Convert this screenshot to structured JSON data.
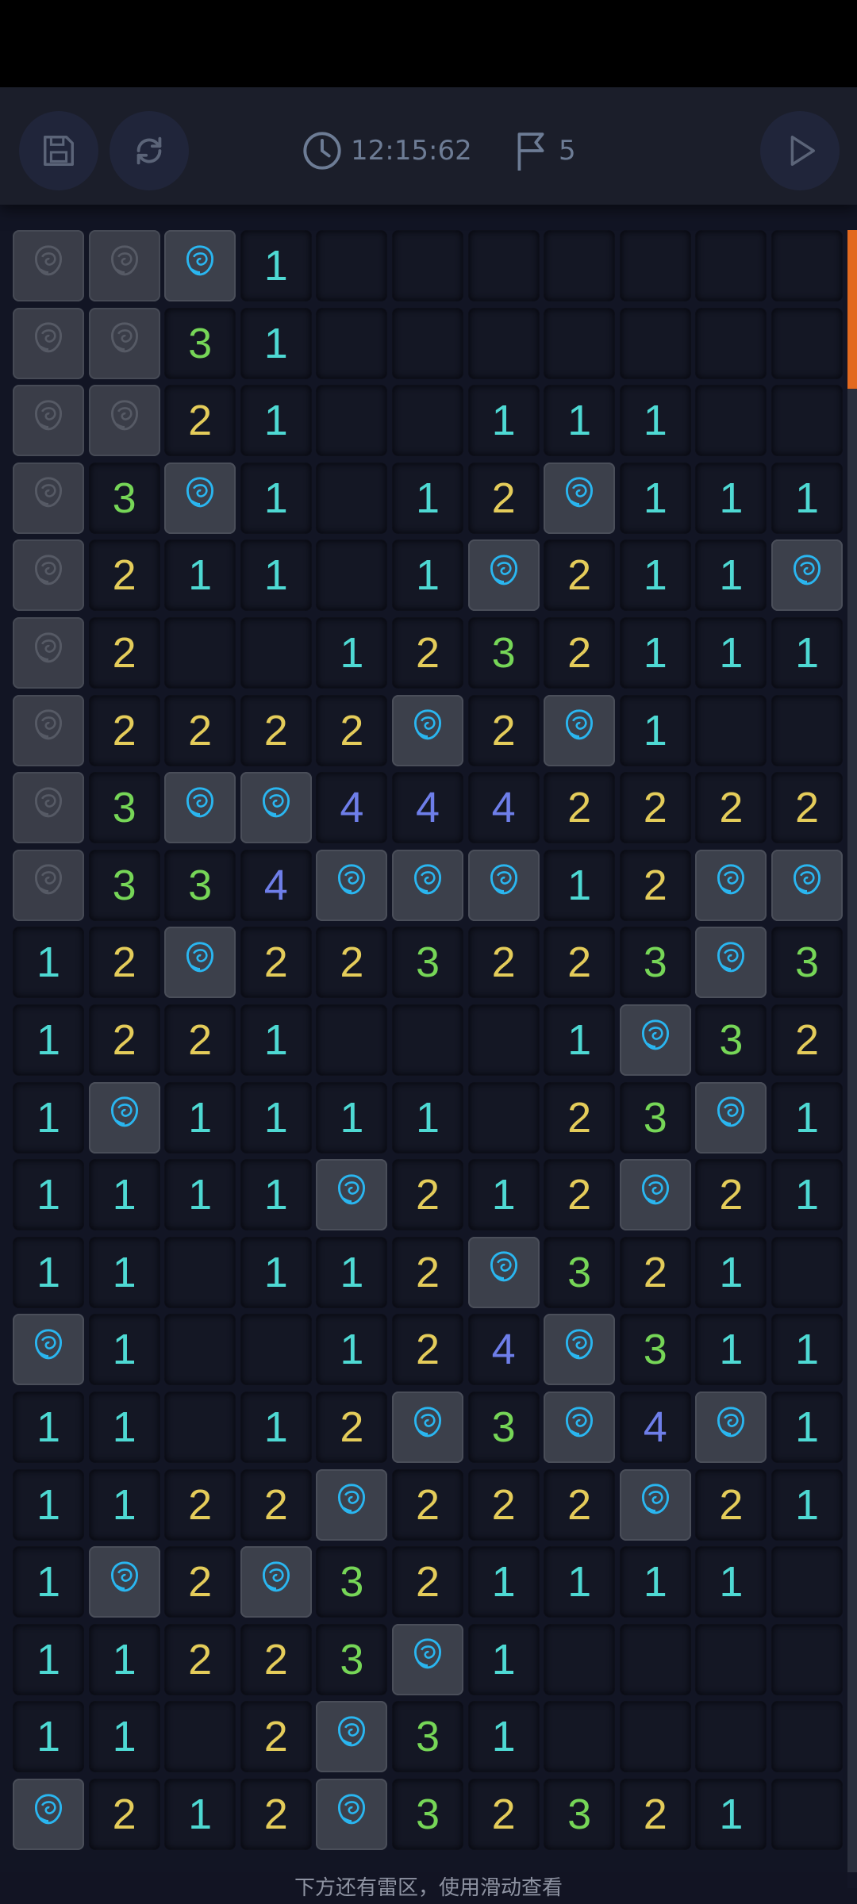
{
  "toolbar": {
    "save_icon": "floppy-disk-icon",
    "restart_icon": "refresh-icon",
    "clock_icon": "clock-icon",
    "timer": "12:15:62",
    "flag_icon": "flag-icon",
    "flag_count": "5",
    "play_icon": "play-icon"
  },
  "board": {
    "columns": 11,
    "legend": "H = unrevealed tile, R = revealed rose (mine), blank = empty opened tile, digit = neighbor count",
    "rows": [
      [
        "H",
        "H",
        "R",
        "1",
        "",
        "",
        "",
        "",
        "",
        "",
        ""
      ],
      [
        "H",
        "H",
        "3",
        "1",
        "",
        "",
        "",
        "",
        "",
        "",
        ""
      ],
      [
        "H",
        "H",
        "2",
        "1",
        "",
        "",
        "1",
        "1",
        "1",
        "",
        ""
      ],
      [
        "H",
        "3",
        "R",
        "1",
        "",
        "1",
        "2",
        "R",
        "1",
        "1",
        "1"
      ],
      [
        "H",
        "2",
        "1",
        "1",
        "",
        "1",
        "R",
        "2",
        "1",
        "1",
        "R"
      ],
      [
        "H",
        "2",
        "",
        "",
        "1",
        "2",
        "3",
        "2",
        "1",
        "1",
        "1"
      ],
      [
        "H",
        "2",
        "2",
        "2",
        "2",
        "R",
        "2",
        "R",
        "1",
        "",
        ""
      ],
      [
        "H",
        "3",
        "R",
        "R",
        "4",
        "4",
        "4",
        "2",
        "2",
        "2",
        "2"
      ],
      [
        "H",
        "3",
        "3",
        "4",
        "R",
        "R",
        "R",
        "1",
        "2",
        "R",
        "R"
      ],
      [
        "1",
        "2",
        "R",
        "2",
        "2",
        "3",
        "2",
        "2",
        "3",
        "R",
        "3"
      ],
      [
        "1",
        "2",
        "2",
        "1",
        "",
        "",
        "",
        "1",
        "R",
        "3",
        "2"
      ],
      [
        "1",
        "R",
        "1",
        "1",
        "1",
        "1",
        "",
        "2",
        "3",
        "R",
        "1"
      ],
      [
        "1",
        "1",
        "1",
        "1",
        "R",
        "2",
        "1",
        "2",
        "R",
        "2",
        "1"
      ],
      [
        "1",
        "1",
        "",
        "1",
        "1",
        "2",
        "R",
        "3",
        "2",
        "1",
        ""
      ],
      [
        "R",
        "1",
        "",
        "",
        "1",
        "2",
        "4",
        "R",
        "3",
        "1",
        "1"
      ],
      [
        "1",
        "1",
        "",
        "1",
        "2",
        "R",
        "3",
        "R",
        "4",
        "R",
        "1"
      ],
      [
        "1",
        "1",
        "2",
        "2",
        "R",
        "2",
        "2",
        "2",
        "R",
        "2",
        "1"
      ],
      [
        "1",
        "R",
        "2",
        "R",
        "3",
        "2",
        "1",
        "1",
        "1",
        "1",
        ""
      ],
      [
        "1",
        "1",
        "2",
        "2",
        "3",
        "R",
        "1",
        "",
        "",
        "",
        ""
      ],
      [
        "1",
        "1",
        "",
        "2",
        "R",
        "3",
        "1",
        "",
        "",
        "",
        ""
      ],
      [
        "R",
        "2",
        "1",
        "2",
        "R",
        "3",
        "2",
        "3",
        "2",
        "1",
        ""
      ]
    ]
  },
  "colors": {
    "one": "#4ed9d3",
    "two": "#e4cc5a",
    "three": "#76d657",
    "four": "#6e7ee9",
    "rose": "#2ab6f0",
    "scroll_thumb": "#e2691f"
  },
  "hint": "下方还有雷区，使用滑动查看"
}
